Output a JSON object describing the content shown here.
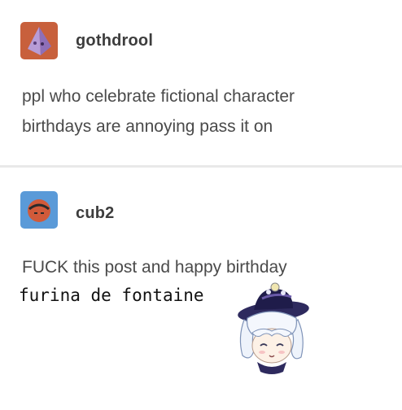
{
  "posts": [
    {
      "username": "gothdrool",
      "lines": [
        "ppl who celebrate fictional character",
        "birthdays are annoying pass it on"
      ],
      "avatar_icon": "pyramid-avatar-icon",
      "avatar_colors": {
        "background": "#c8603c",
        "shape": "#b79cd6"
      }
    },
    {
      "username": "cub2",
      "lines": [
        "FUCK this post and happy birthday"
      ],
      "reply_line": "furina de fontaine",
      "avatar_icon": "round-avatar-icon",
      "avatar_colors": {
        "background": "#5a9ad8",
        "shape": "#d15a3a"
      }
    }
  ],
  "sticker_icon": "chibi-character-sticker"
}
